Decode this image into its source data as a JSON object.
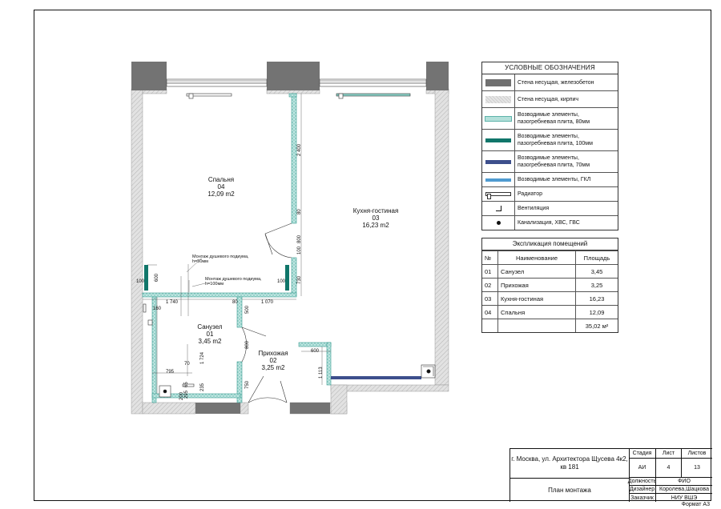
{
  "plan": {
    "rooms": [
      {
        "name": "Спальня",
        "num": "04",
        "area": "12,09 m2"
      },
      {
        "name": "Кухня-гостиная",
        "num": "03",
        "area": "16,23 m2"
      },
      {
        "name": "Санузел",
        "num": "01",
        "area": "3,45 m2"
      },
      {
        "name": "Прихожая",
        "num": "02",
        "area": "3,25 m2"
      }
    ],
    "notes": {
      "shower_50_l1": "Монтаж душевого подиума,",
      "shower_50_l2": "h=50мм",
      "shower_100_l1": "Монтаж душевого подиума,",
      "shower_100_l2": "h=100мм"
    },
    "dims": {
      "d2400": "2 400",
      "d80a": "80",
      "d800a": "800",
      "d730": "730",
      "d100a": "100",
      "d100b": "100",
      "d100c": "100",
      "d600a": "600",
      "d1740": "1 740",
      "d80b": "80",
      "d1070": "1 070",
      "d160": "160",
      "d500": "500",
      "d800b": "800",
      "d1724": "1 724",
      "d70": "70",
      "d795": "795",
      "d750": "750",
      "d600b": "600",
      "d1113": "1 113",
      "d200": "200",
      "d235": "235",
      "d295": "295",
      "d65": "65"
    }
  },
  "legend": {
    "title": "УСЛОВНЫЕ ОБОЗНАЧЕНИЯ",
    "items": [
      {
        "label": "Стена несущая, железобетон",
        "icon": "concrete-wall-swatch"
      },
      {
        "label": "Стена несущая, кирпич",
        "icon": "brick-wall-swatch"
      },
      {
        "label": "Возводимые элементы, пазогребневая плита, 80мм",
        "icon": "tongue-groove-80-swatch"
      },
      {
        "label": "Возводимые элементы, пазогребневая плита, 100мм",
        "icon": "tongue-groove-100-swatch"
      },
      {
        "label": "Возводимые элементы, пазогребневая плита, 70мм",
        "icon": "tongue-groove-70-swatch"
      },
      {
        "label": "Возводимые элементы, ГКЛ",
        "icon": "drywall-swatch"
      },
      {
        "label": "Радиатор",
        "icon": "radiator-icon"
      },
      {
        "label": "Вентиляция",
        "icon": "ventilation-icon"
      },
      {
        "label": "Канализация, ХВС, ГВС",
        "icon": "sewer-dot-icon"
      }
    ],
    "colors": {
      "concrete": "#707070",
      "brick": "#d4d4d4",
      "tg80": "#a8dcd6",
      "tg100": "#10766a",
      "tg70": "#3d4f8c",
      "gkl": "#4f9bd1"
    }
  },
  "explication": {
    "title": "Экспликация помещений",
    "headers": [
      "№",
      "Наименование",
      "Площадь"
    ],
    "rows": [
      [
        "01",
        "Санузел",
        "3,45"
      ],
      [
        "02",
        "Прихожая",
        "3,25"
      ],
      [
        "03",
        "Кухня-гостиная",
        "16,23"
      ],
      [
        "04",
        "Спальня",
        "12,09"
      ]
    ],
    "total": "35,02 м²"
  },
  "titleblock": {
    "address": "г. Москва, ул. Архитектора Щусева 4к2, кв 181",
    "sheet_name": "План монтажа",
    "stage_h": "Стадия",
    "sheet_h": "Лист",
    "sheets_h": "Листов",
    "stage": "АИ",
    "sheet": "4",
    "sheets": "13",
    "role_h": "Должность",
    "fio_h": "ФИО",
    "designer_h": "Дизайнер",
    "designer": "Королева,Шацкова",
    "customer_h": "Заказчик",
    "customer": "НИУ ВШЭ"
  },
  "format": "Формат А3"
}
